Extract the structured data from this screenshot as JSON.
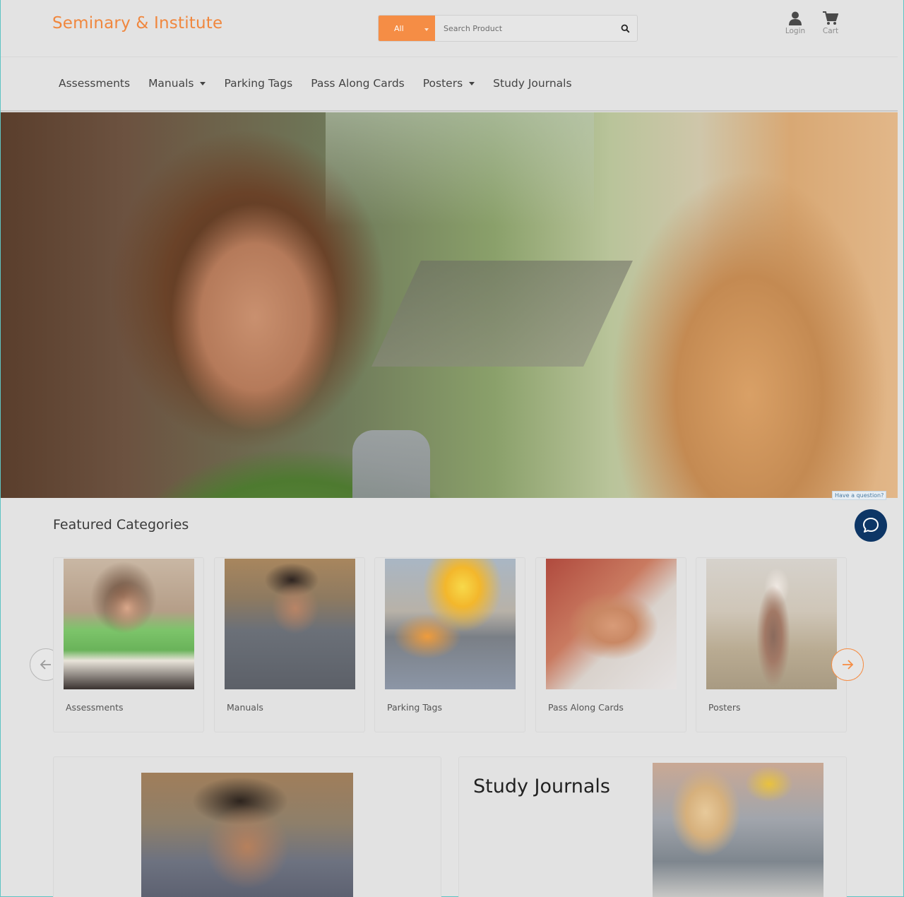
{
  "header": {
    "brand": "Seminary & Institute",
    "search": {
      "category": "All",
      "placeholder": "Search Product",
      "icon": "search-icon"
    },
    "login_label": "Login",
    "cart_label": "Cart",
    "brand_color": "#f0873e",
    "accent_color": "#f58d45"
  },
  "nav": {
    "items": [
      {
        "label": "Assessments",
        "dropdown": false
      },
      {
        "label": "Manuals",
        "dropdown": true
      },
      {
        "label": "Parking Tags",
        "dropdown": false
      },
      {
        "label": "Pass Along Cards",
        "dropdown": false
      },
      {
        "label": "Posters",
        "dropdown": true
      },
      {
        "label": "Study Journals",
        "dropdown": false
      }
    ]
  },
  "hero": {
    "chat_prompt": "Have a question?"
  },
  "featured": {
    "title": "Featured Categories",
    "cards": [
      {
        "label": "Assessments"
      },
      {
        "label": "Manuals"
      },
      {
        "label": "Parking Tags"
      },
      {
        "label": "Pass Along Cards"
      },
      {
        "label": "Posters"
      }
    ]
  },
  "promo": {
    "right_title": "Study Journals"
  },
  "chat": {
    "icon": "chat-bubble-icon",
    "color": "#0d3666"
  }
}
